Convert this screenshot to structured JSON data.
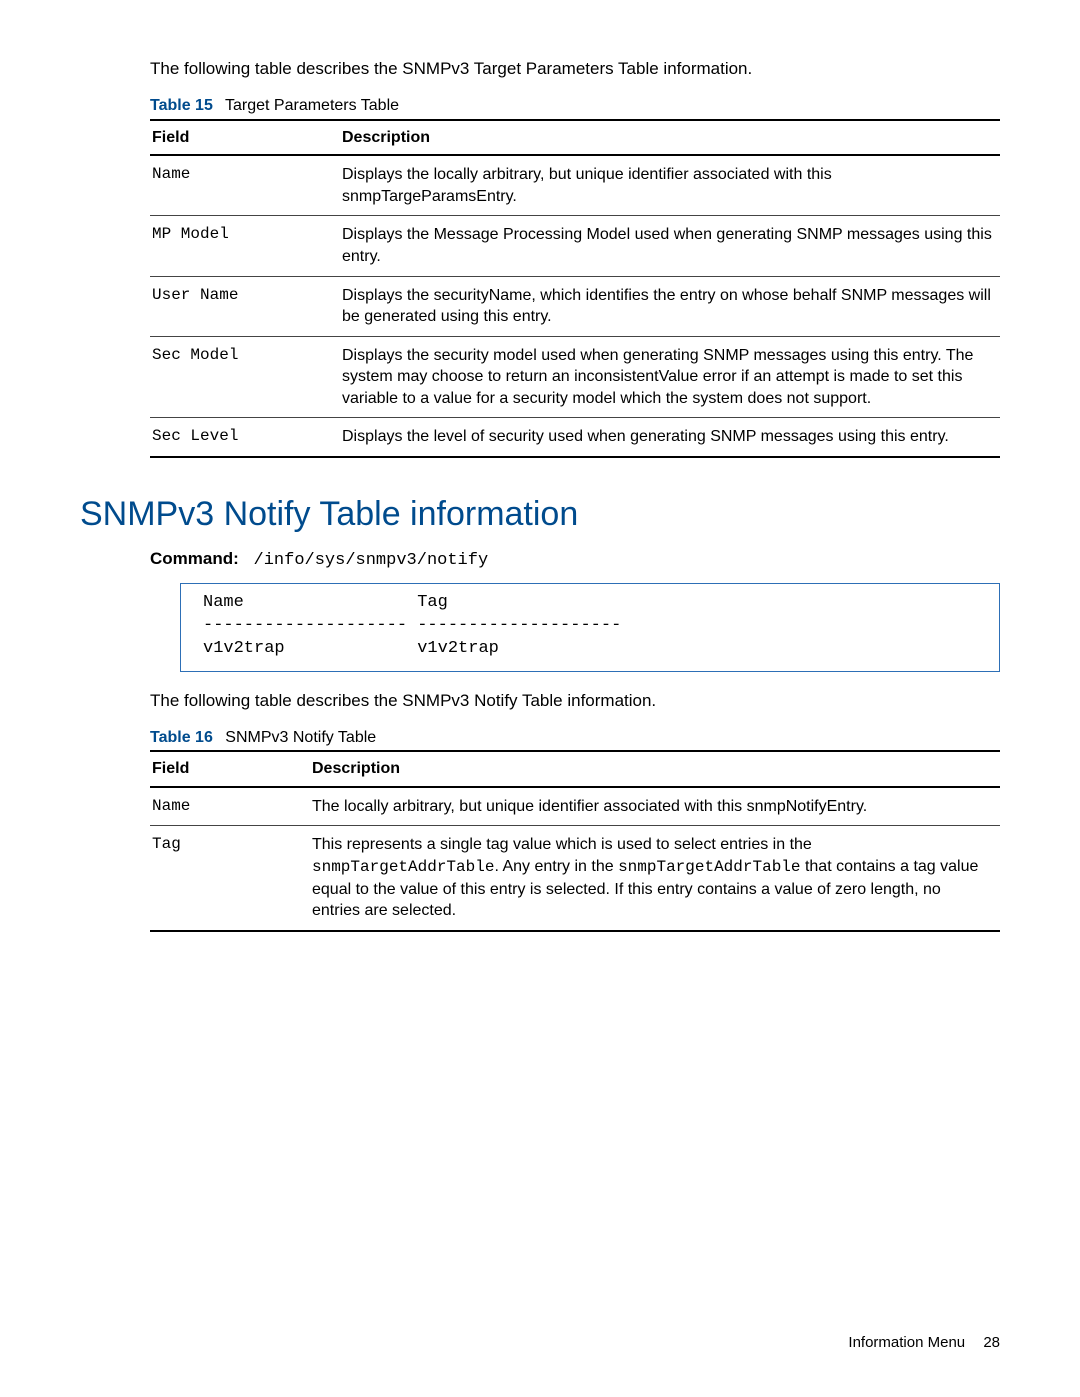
{
  "intro1": "The following table describes the SNMPv3 Target Parameters Table information.",
  "table15": {
    "num": "Table 15",
    "title": "Target Parameters Table",
    "head_field": "Field",
    "head_desc": "Description",
    "rows": [
      {
        "field": "Name",
        "desc": "Displays the locally arbitrary, but unique identifier associated with this snmpTargeParamsEntry."
      },
      {
        "field": "MP Model",
        "desc": "Displays the Message Processing Model used when generating SNMP messages using this entry."
      },
      {
        "field": "User Name",
        "desc": "Displays the securityName, which identifies the entry on whose behalf SNMP messages will be generated using this entry."
      },
      {
        "field": "Sec Model",
        "desc": "Displays the security model used when generating SNMP messages using this entry. The system may choose to return an inconsistentValue error if an attempt is made to set this variable to a value for a security model which the system does not support."
      },
      {
        "field": "Sec Level",
        "desc": "Displays the level of security used when generating SNMP messages using this entry."
      }
    ]
  },
  "section_heading": "SNMPv3 Notify Table information",
  "command_label": "Command:",
  "command_path": "/info/sys/snmpv3/notify",
  "code_block": "Name                 Tag\n-------------------- --------------------\nv1v2trap             v1v2trap",
  "intro2": "The following table describes the SNMPv3 Notify Table information.",
  "table16": {
    "num": "Table 16",
    "title": "SNMPv3 Notify Table",
    "head_field": "Field",
    "head_desc": "Description",
    "rows": [
      {
        "field": "Name",
        "desc_plain": "The locally arbitrary, but unique identifier associated with this snmpNotifyEntry."
      },
      {
        "field": "Tag",
        "desc_parts": {
          "p1": "This represents a single tag value which is used to select entries in the ",
          "m1": "snmpTargetAddrTable",
          "p2": ". Any entry in the ",
          "m2": "snmpTargetAddrTable",
          "p3": " that contains a tag value equal to the value of this entry is selected. If this entry contains a value of zero length, no entries are selected."
        }
      }
    ]
  },
  "footer_section": "Information Menu",
  "footer_page": "28"
}
